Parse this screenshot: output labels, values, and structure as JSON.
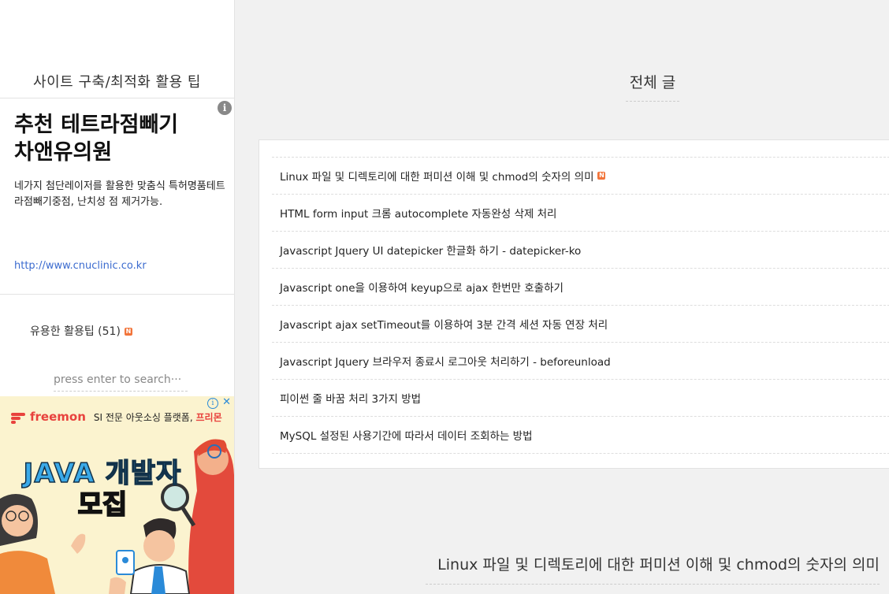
{
  "sidebar": {
    "blog_title": "사이트 구축/최적화 활용 팁",
    "ad1": {
      "info_glyph": "i",
      "title_line1": "추천 테트라점빼기",
      "title_line2": "차앤유의원",
      "desc": "네가지 첨단레이저를 활용한 맞춤식 특허명품테트라점빼기중점, 난치성 점 제거가능.",
      "url": "http://www.cnuclinic.co.kr"
    },
    "category": {
      "label": "유용한 활용팁 (51)",
      "badge": "N"
    },
    "search": {
      "placeholder": "press enter to search···"
    },
    "ad2": {
      "brand": "freemon",
      "tagline": "SI 전문 아웃소싱 플랫폼,",
      "tagline_highlight": "프리몬",
      "headline_line1": "JAVA 개발자",
      "headline_line2": "모집",
      "info_glyph": "i",
      "close_glyph": "✕",
      "accent_color": "#e8423d"
    }
  },
  "main": {
    "title": "전체 글",
    "posts": [
      {
        "title": "Linux 파일 및 디렉토리에 대한 퍼미션 이해 및 chmod의 숫자의 의미",
        "badge": "N"
      },
      {
        "title": "HTML form input 크롬 autocomplete 자동완성 삭제 처리"
      },
      {
        "title": "Javascript Jquery UI datepicker 한글화 하기 - datepicker-ko"
      },
      {
        "title": "Javascript one을 이용하여 keyup으로 ajax 한번만 호출하기"
      },
      {
        "title": "Javascript ajax setTimeout를 이용하여 3분 간격 세션 자동 연장 처리"
      },
      {
        "title": "Javascript Jquery 브라우저 종료시 로그아웃 처리하기 - beforeunload"
      },
      {
        "title": "피이썬 줄 바꿈 처리 3가지 방법"
      },
      {
        "title": "MySQL 설정된 사용기간에 따라서 데이터 조회하는 방법"
      }
    ],
    "bottom_post_title": "Linux 파일 및 디렉토리에 대한 퍼미션 이해 및 chmod의 숫자의 의미"
  }
}
